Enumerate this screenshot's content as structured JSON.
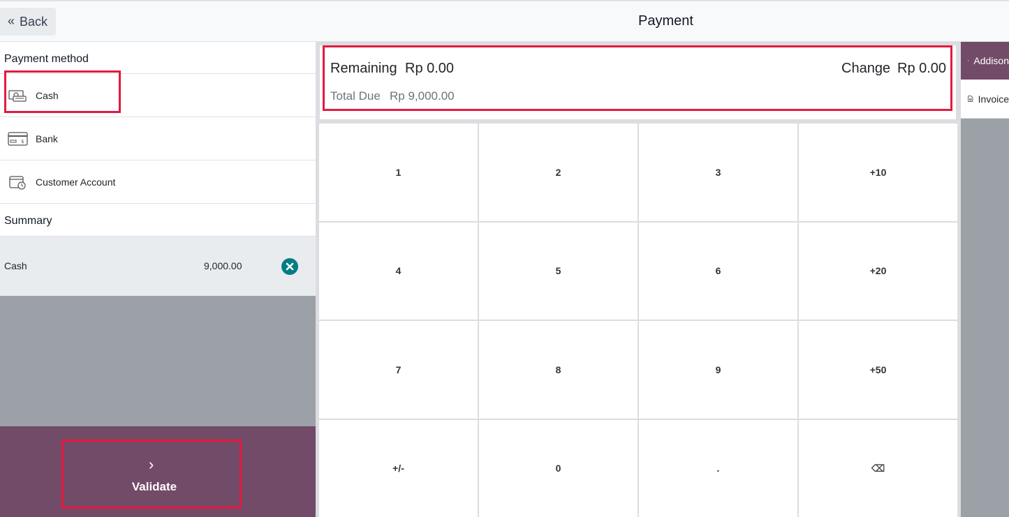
{
  "header": {
    "back_label": "Back",
    "title": "Payment"
  },
  "payment_methods": {
    "title": "Payment method",
    "items": [
      {
        "label": "Cash",
        "icon": "cash-icon"
      },
      {
        "label": "Bank",
        "icon": "bank-card-icon"
      },
      {
        "label": "Customer Account",
        "icon": "wallet-clock-icon"
      }
    ]
  },
  "summary": {
    "title": "Summary",
    "lines": [
      {
        "method": "Cash",
        "amount": "9,000.00"
      }
    ]
  },
  "status": {
    "remaining_label": "Remaining",
    "remaining_value": "Rp 0.00",
    "change_label": "Change",
    "change_value": "Rp 0.00",
    "total_due_label": "Total Due",
    "total_due_value": "Rp 9,000.00"
  },
  "numpad": {
    "keys": [
      "1",
      "2",
      "3",
      "+10",
      "4",
      "5",
      "6",
      "+20",
      "7",
      "8",
      "9",
      "+50",
      "+/-",
      "0",
      ".",
      "⌫"
    ]
  },
  "validate": {
    "label": "Validate"
  },
  "sidebar": {
    "customer_label": "Addison",
    "invoice_label": "Invoice"
  },
  "colors": {
    "brand": "#714b67",
    "highlight_border": "#e5193f",
    "delete": "#017e84"
  }
}
